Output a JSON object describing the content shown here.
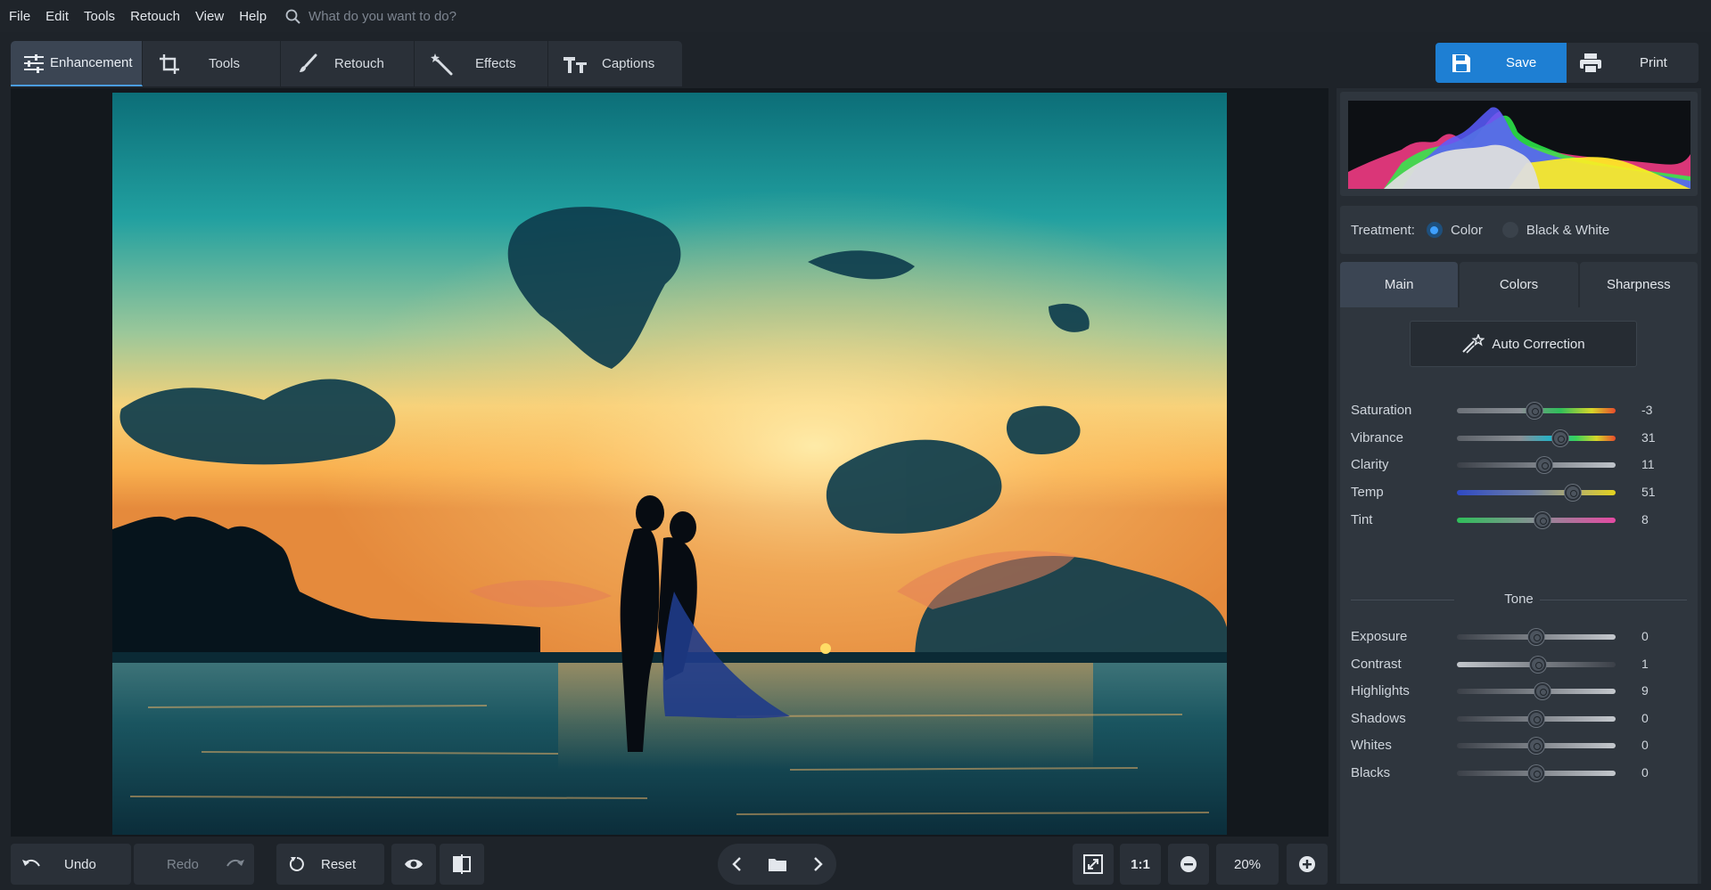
{
  "menu": [
    "File",
    "Edit",
    "Tools",
    "Retouch",
    "View",
    "Help"
  ],
  "search": {
    "placeholder": "What do you want to do?"
  },
  "toolbar": {
    "tabs": [
      {
        "label": "Enhancement",
        "icon": "sliders-icon"
      },
      {
        "label": "Tools",
        "icon": "crop-icon"
      },
      {
        "label": "Retouch",
        "icon": "brush-icon"
      },
      {
        "label": "Effects",
        "icon": "magic-wand-icon"
      },
      {
        "label": "Captions",
        "icon": "text-icon"
      }
    ],
    "save_label": "Save",
    "print_label": "Print"
  },
  "bottom": {
    "undo": "Undo",
    "redo": "Redo",
    "reset": "Reset",
    "actual_size": "1:1",
    "zoom": "20%"
  },
  "panel": {
    "treatment_label": "Treatment:",
    "treatment_options": [
      "Color",
      "Black & White"
    ],
    "treatment_selected": "Color",
    "tabs": [
      "Main",
      "Colors",
      "Sharpness"
    ],
    "active_tab": "Main",
    "auto_correction": "Auto Correction",
    "tone_header": "Tone",
    "color_sliders": [
      {
        "label": "Saturation",
        "value": "-3"
      },
      {
        "label": "Vibrance",
        "value": "31"
      },
      {
        "label": "Clarity",
        "value": "11"
      },
      {
        "label": "Temp",
        "value": "51"
      },
      {
        "label": "Tint",
        "value": "8"
      }
    ],
    "tone_sliders": [
      {
        "label": "Exposure",
        "value": "0"
      },
      {
        "label": "Contrast",
        "value": "1"
      },
      {
        "label": "Highlights",
        "value": "9"
      },
      {
        "label": "Shadows",
        "value": "0"
      },
      {
        "label": "Whites",
        "value": "0"
      },
      {
        "label": "Blacks",
        "value": "0"
      }
    ]
  },
  "colors": {
    "accent": "#1e7fd3",
    "panel_bg": "#2f363e"
  }
}
